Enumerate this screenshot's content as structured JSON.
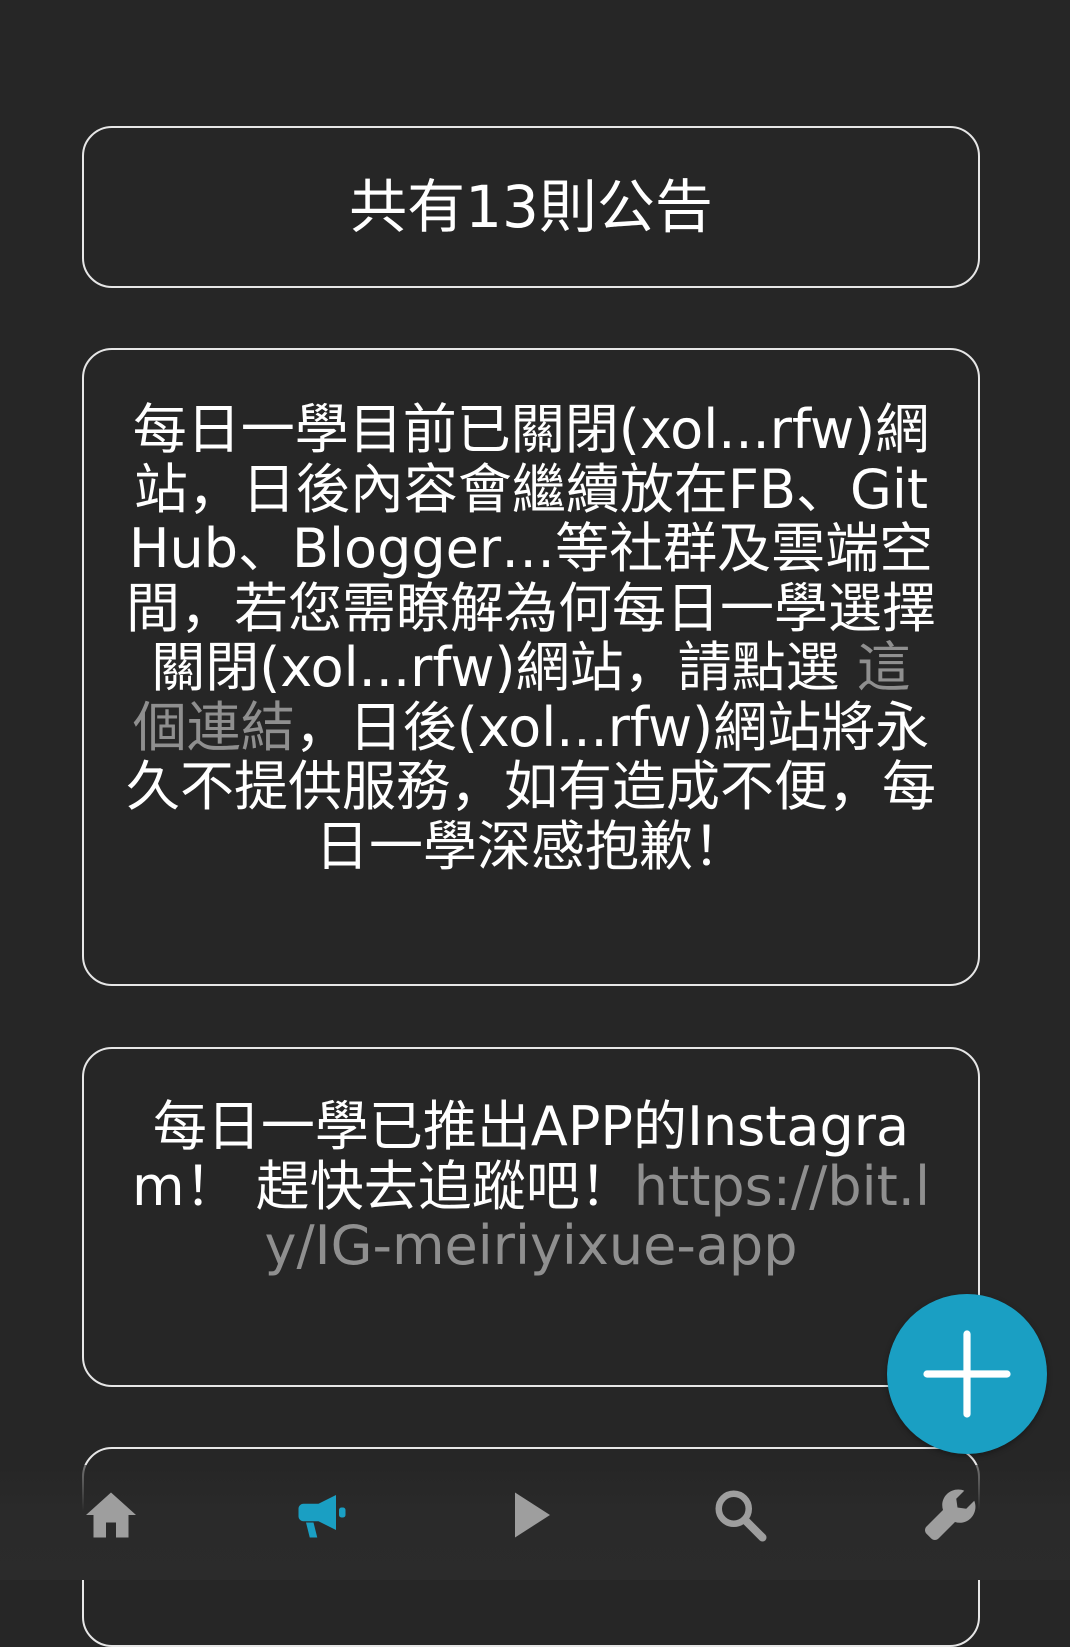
{
  "announcement_count": "共有13則公告",
  "announcements": [
    {
      "text_before_link": "每日一學目前已關閉(xol...rfw)網站，日後內容會繼續放在FB、GitHub、Blogger…等社群及雲端空間，若您需瞭解為何每日一學選擇關閉(xol...rfw)網站，請點選 ",
      "link_text": "這個連結",
      "text_after_link": "，日後(xol...rfw)網站將永久不提供服務，如有造成不便，每日一學深感抱歉！"
    },
    {
      "text_before_link": "每日一學已推出APP的Instagram！ 趕快去追蹤吧！",
      "link_text": "https://bit.ly/IG-meiriyixue-app"
    }
  ],
  "fab": {
    "icon": "plus-icon",
    "color": "#1a9fc3"
  },
  "bottom_nav": {
    "items": [
      {
        "icon": "home-icon",
        "active": false
      },
      {
        "icon": "megaphone-icon",
        "active": true
      },
      {
        "icon": "play-icon",
        "active": false
      },
      {
        "icon": "search-icon",
        "active": false
      },
      {
        "icon": "wrench-icon",
        "active": false
      }
    ],
    "active_color": "#1a9fc3",
    "inactive_color": "#9e9e9e"
  }
}
